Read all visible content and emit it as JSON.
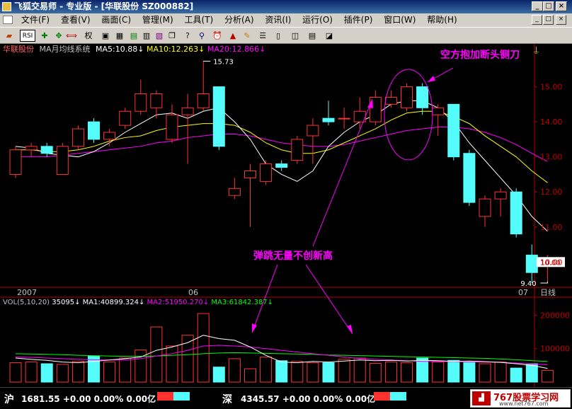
{
  "window": {
    "title": "飞狐交易师 - 专业版 - [华联股份 SZ000882]",
    "min_label": "_",
    "max_label": "□",
    "close_label": "×"
  },
  "menu": {
    "items": [
      "文件(F)",
      "查看(V)",
      "画面(C)",
      "管理(M)",
      "工具(T)",
      "分析(A)",
      "资讯(I)",
      "运行(O)",
      "插件(P)",
      "窗口(W)",
      "帮助(H)"
    ]
  },
  "toolbar": {
    "quan_label": "权",
    "rsi_label": "RSI"
  },
  "chart": {
    "stock_name": "华联股份",
    "indicator": "MA月均线系统",
    "ma5": "MA5:10.88",
    "ma10": "MA10:12.263",
    "ma20": "MA20:12.866",
    "colors": {
      "up": "#ff3232",
      "down": "#54fcfc",
      "ma5": "#ffffff",
      "ma10": "#ffff00",
      "ma20": "#ff00ff",
      "axis": "#b40000",
      "annot": "#ff00ff"
    },
    "price_ticks": [
      "15.00",
      "14.00",
      "13.00",
      "12.00",
      "11.00",
      "10.00"
    ],
    "current_price": "10.00",
    "high_label": "15.73",
    "low_label": "9.40",
    "x_labels": [
      "2007",
      "06",
      "07"
    ],
    "period_label": "日线"
  },
  "volume": {
    "header": "VOL(5,10,20)",
    "value": "35095",
    "ma1": "MA1:40899.324",
    "ma2": "MA2:51950.270",
    "ma3": "MA3:61842.387",
    "ticks": [
      "200000",
      "100000"
    ]
  },
  "annotations": {
    "top_right": "空方抱加断头铡刀",
    "middle": "弹跳无量不创新高"
  },
  "status": {
    "sh_label": "沪",
    "sh_quote": "1681.55 +0.00 0.00% 0.00亿",
    "sz_label": "深",
    "sz_quote": "4345.57 +0.00 0.00% 0.00亿"
  },
  "watermark": "767股票学习网",
  "watermark_url": "www.net767.com",
  "chart_data": {
    "type": "candlestick",
    "ylim": [
      9.3,
      15.9
    ],
    "candles": [
      {
        "o": 12.5,
        "c": 13.2,
        "h": 13.3,
        "l": 12.4
      },
      {
        "o": 13.2,
        "c": 13.3,
        "h": 13.4,
        "l": 13.0
      },
      {
        "o": 13.3,
        "c": 13.1,
        "h": 13.4,
        "l": 13.0
      },
      {
        "o": 12.5,
        "c": 13.3,
        "h": 13.4,
        "l": 12.5
      },
      {
        "o": 13.3,
        "c": 13.8,
        "h": 13.9,
        "l": 13.2
      },
      {
        "o": 14.0,
        "c": 13.5,
        "h": 14.1,
        "l": 13.4
      },
      {
        "o": 13.5,
        "c": 13.7,
        "h": 13.8,
        "l": 13.3
      },
      {
        "o": 13.9,
        "c": 14.3,
        "h": 14.4,
        "l": 13.8
      },
      {
        "o": 14.3,
        "c": 14.8,
        "h": 15.2,
        "l": 14.2
      },
      {
        "o": 14.4,
        "c": 14.8,
        "h": 14.9,
        "l": 14.1
      },
      {
        "o": 13.5,
        "c": 14.2,
        "h": 14.5,
        "l": 13.4
      },
      {
        "o": 14.2,
        "c": 14.4,
        "h": 14.8,
        "l": 12.8
      },
      {
        "o": 14.4,
        "c": 14.8,
        "h": 15.73,
        "l": 14.3
      },
      {
        "o": 15.0,
        "c": 13.3,
        "h": 15.0,
        "l": 13.2
      },
      {
        "o": 11.9,
        "c": 12.1,
        "h": 12.4,
        "l": 11.8
      },
      {
        "o": 12.4,
        "c": 12.6,
        "h": 12.8,
        "l": 11.0
      },
      {
        "o": 12.3,
        "c": 12.8,
        "h": 12.9,
        "l": 12.2
      },
      {
        "o": 12.8,
        "c": 12.7,
        "h": 12.9,
        "l": 12.6
      },
      {
        "o": 12.9,
        "c": 13.5,
        "h": 13.6,
        "l": 12.8
      },
      {
        "o": 13.6,
        "c": 13.9,
        "h": 14.1,
        "l": 12.8
      },
      {
        "o": 14.1,
        "c": 14.0,
        "h": 14.6,
        "l": 13.9
      },
      {
        "o": 14.1,
        "c": 14.1,
        "h": 14.4,
        "l": 13.8
      },
      {
        "o": 14.0,
        "c": 14.3,
        "h": 14.7,
        "l": 13.8
      },
      {
        "o": 14.0,
        "c": 14.7,
        "h": 14.9,
        "l": 13.9
      },
      {
        "o": 14.5,
        "c": 14.7,
        "h": 14.9,
        "l": 14.4
      },
      {
        "o": 14.4,
        "c": 15.0,
        "h": 15.1,
        "l": 14.3
      },
      {
        "o": 15.0,
        "c": 14.4,
        "h": 15.1,
        "l": 14.2
      },
      {
        "o": 14.2,
        "c": 14.4,
        "h": 14.5,
        "l": 13.6
      },
      {
        "o": 14.5,
        "c": 13.0,
        "h": 14.5,
        "l": 12.9
      },
      {
        "o": 13.1,
        "c": 11.7,
        "h": 13.2,
        "l": 11.6
      },
      {
        "o": 11.3,
        "c": 11.8,
        "h": 11.9,
        "l": 11.0
      },
      {
        "o": 11.8,
        "c": 12.0,
        "h": 12.1,
        "l": 11.3
      },
      {
        "o": 12.0,
        "c": 10.8,
        "h": 12.1,
        "l": 10.7
      },
      {
        "o": 10.2,
        "c": 9.7,
        "h": 10.5,
        "l": 9.4
      },
      {
        "o": 10.0,
        "c": 10.0,
        "h": 10.2,
        "l": 9.45
      }
    ],
    "ma5": [
      13.3,
      13.25,
      13.1,
      13.05,
      13.0,
      13.15,
      13.4,
      13.7,
      13.95,
      14.2,
      14.25,
      14.1,
      14.3,
      14.4,
      14.0,
      13.5,
      12.8,
      12.5,
      12.3,
      12.6,
      13.3,
      13.7,
      14.0,
      14.2,
      14.5,
      14.6,
      14.6,
      14.4,
      14.0,
      13.4,
      12.9,
      12.4,
      11.9,
      11.3,
      10.88
    ],
    "ma10": [
      13.2,
      13.2,
      13.15,
      13.15,
      13.2,
      13.3,
      13.45,
      13.55,
      13.6,
      13.75,
      13.85,
      13.9,
      13.95,
      13.95,
      13.9,
      13.7,
      13.4,
      13.2,
      13.1,
      13.1,
      13.2,
      13.4,
      13.6,
      13.8,
      14.05,
      14.25,
      14.3,
      14.3,
      14.15,
      13.95,
      13.6,
      13.3,
      13.0,
      12.6,
      12.263
    ],
    "ma20": [
      13.0,
      13.0,
      13.0,
      13.05,
      13.1,
      13.15,
      13.2,
      13.25,
      13.3,
      13.4,
      13.45,
      13.55,
      13.6,
      13.65,
      13.65,
      13.6,
      13.5,
      13.4,
      13.35,
      13.3,
      13.3,
      13.35,
      13.45,
      13.55,
      13.65,
      13.75,
      13.8,
      13.85,
      13.85,
      13.8,
      13.7,
      13.55,
      13.35,
      13.1,
      12.866
    ],
    "volume": [
      58000,
      60000,
      55000,
      53000,
      62000,
      78000,
      60000,
      72000,
      96000,
      165000,
      108000,
      140000,
      205000,
      45000,
      70000,
      40000,
      75000,
      64000,
      62000,
      58000,
      58000,
      68000,
      72000,
      56000,
      60000,
      58000,
      72000,
      60000,
      65000,
      62000,
      55000,
      60000,
      42000,
      55000,
      35095
    ],
    "vol_ma1": [
      72000,
      68000,
      65000,
      60000,
      58000,
      62000,
      66000,
      70000,
      75000,
      95000,
      105000,
      118000,
      140000,
      130000,
      125000,
      105000,
      80000,
      60000,
      58000,
      62000,
      60000,
      63000,
      66000,
      64000,
      65000,
      63000,
      65000,
      64000,
      62000,
      63000,
      61000,
      59000,
      55000,
      50000,
      40899
    ],
    "vol_ma2": [
      75000,
      74000,
      72000,
      70000,
      68000,
      67000,
      66000,
      66000,
      70000,
      78000,
      85000,
      95000,
      108000,
      110000,
      108000,
      105000,
      100000,
      95000,
      90000,
      85000,
      80000,
      75000,
      70000,
      68000,
      66000,
      64000,
      62000,
      62000,
      61000,
      60000,
      60000,
      59000,
      57000,
      54000,
      51950
    ],
    "vol_ma3": [
      85000,
      84000,
      83000,
      82000,
      80000,
      79000,
      78000,
      77000,
      77000,
      78000,
      80000,
      82000,
      85000,
      87000,
      88000,
      87000,
      86000,
      85000,
      84000,
      83000,
      81000,
      80000,
      79000,
      78000,
      77000,
      76000,
      75000,
      74000,
      73000,
      72000,
      71000,
      69000,
      67000,
      64000,
      61842
    ],
    "vol_ylim": [
      0,
      220000
    ]
  }
}
